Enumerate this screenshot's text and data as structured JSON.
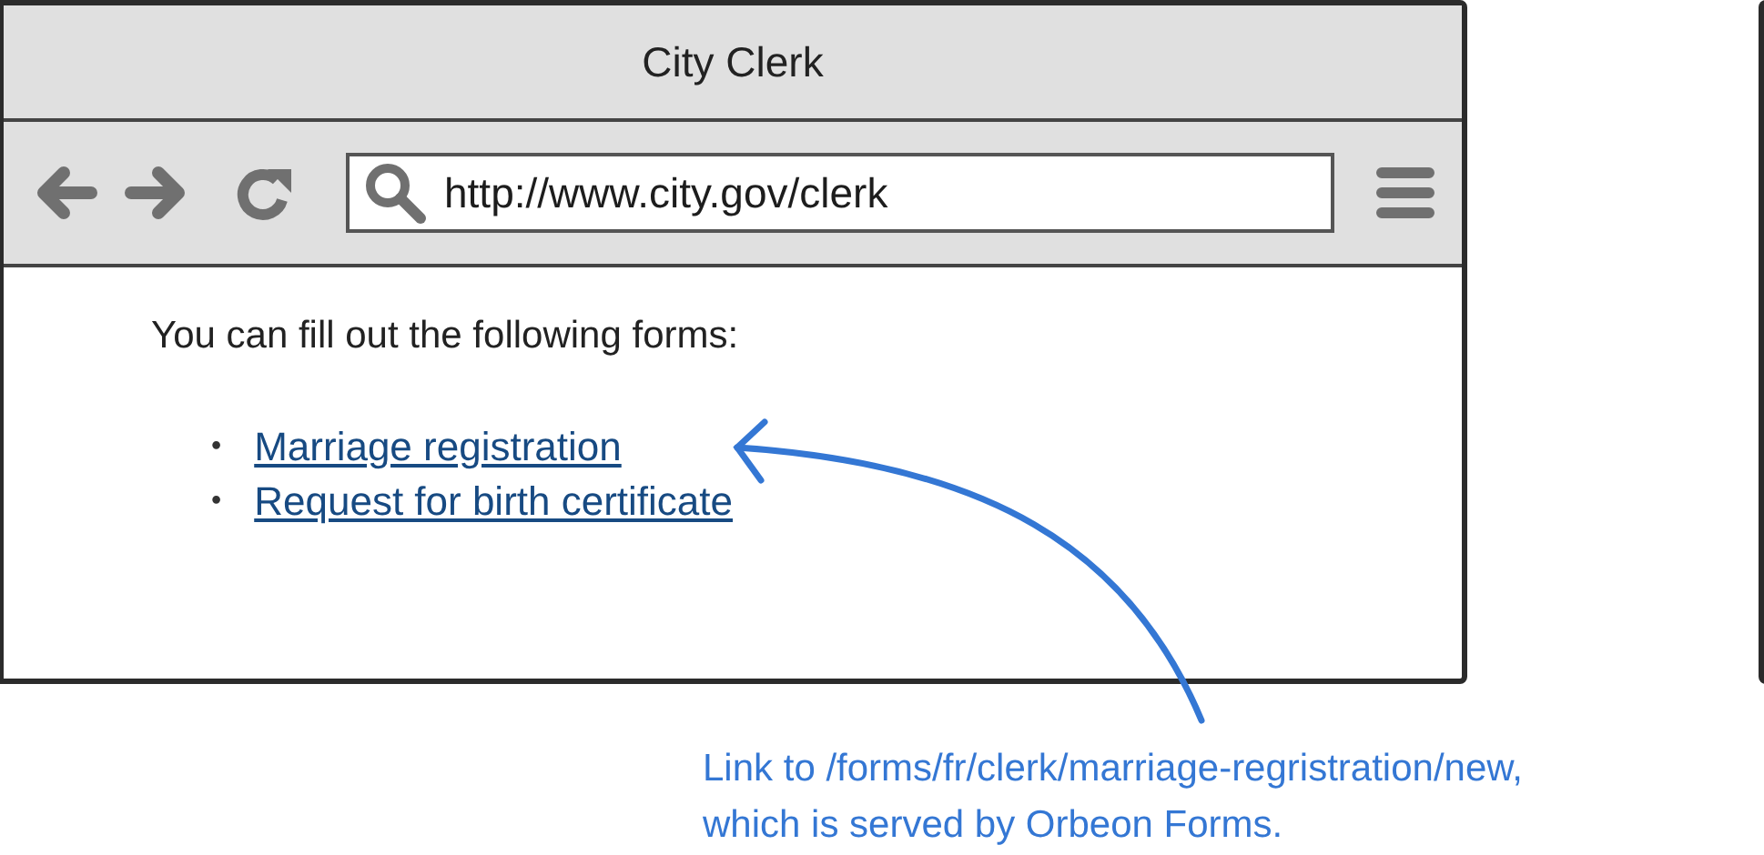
{
  "window": {
    "title": "City Clerk"
  },
  "toolbar": {
    "url": "http://www.city.gov/clerk"
  },
  "content": {
    "intro": "You can fill out the following forms:",
    "links": [
      {
        "bullet": "•",
        "label": "Marriage registration"
      },
      {
        "bullet": "•",
        "label": "Request for birth certificate"
      }
    ]
  },
  "annotation": {
    "lines": [
      "Link to /forms/fr/clerk/marriage-regristration/new,",
      "which is served by Orbeon Forms."
    ]
  }
}
